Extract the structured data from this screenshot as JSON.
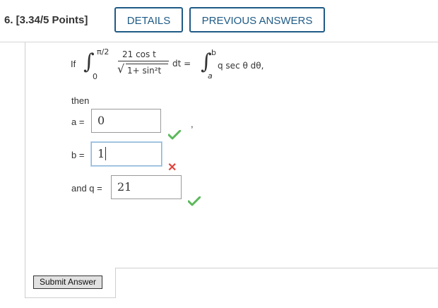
{
  "header": {
    "question_label": "6.  [3.34/5 Points]",
    "details_label": "DETAILS",
    "previous_answers_label": "PREVIOUS ANSWERS"
  },
  "problem": {
    "if_text": "If",
    "lower_limit_left": "0",
    "upper_limit_left": "π/2",
    "numerator": "21 cos t",
    "denominator": "1+ sin²t",
    "dt_eq": "dt =",
    "lower_limit_right": "a",
    "upper_limit_right": "b",
    "integrand_right": "q sec θ  dθ,",
    "then_text": "then",
    "comma": ","
  },
  "answers": {
    "a_label": "a =",
    "a_value": "0",
    "a_status": "correct",
    "b_label": "b =",
    "b_value": "1",
    "b_status": "incorrect",
    "q_label": "and q =",
    "q_value": "21",
    "q_status": "correct"
  },
  "submit_label": "Submit Answer",
  "colors": {
    "accent": "#1f5b86",
    "correct": "#5cb85c",
    "incorrect": "#e0443d"
  }
}
